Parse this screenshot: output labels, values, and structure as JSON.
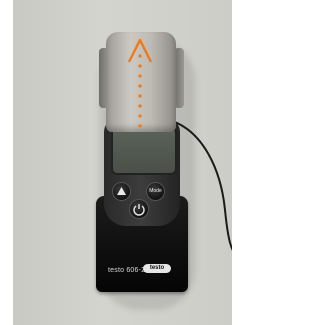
{
  "photo": {
    "device_label": "testo 606-2",
    "brand_logo": "testo",
    "mode_button_label": "Mode"
  },
  "colors": {
    "background_wall": "#cdcdc8",
    "device_body": "#2a2a2a",
    "probe_cap": "#bdbab3",
    "arrow_accent": "#f07a1a"
  },
  "icons": [
    "up-arrow-icon",
    "power-icon",
    "orange-direction-arrow"
  ]
}
